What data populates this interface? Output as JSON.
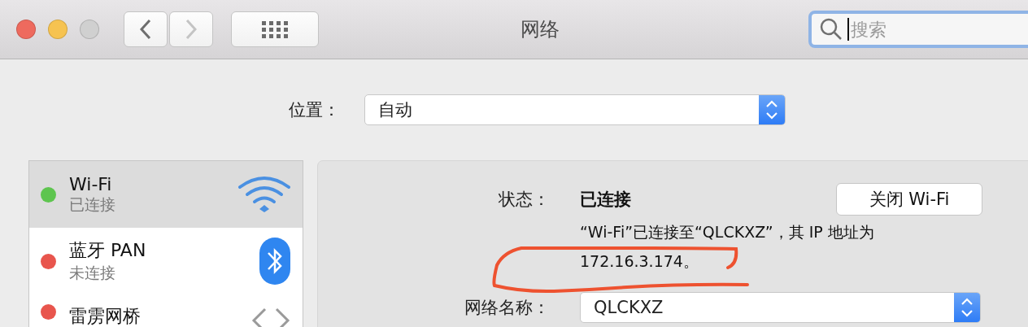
{
  "window": {
    "title": "网络"
  },
  "nav": [
    {
      "kind": "back",
      "disabled": false
    },
    {
      "kind": "forward",
      "disabled": true
    }
  ],
  "search": {
    "placeholder": "搜索",
    "focused": true
  },
  "location": {
    "label": "位置：",
    "value": "自动"
  },
  "services": [
    {
      "kind": "wifi",
      "name": "Wi-Fi",
      "status": "已连接",
      "color": "#5ec54f",
      "selected": true
    },
    {
      "kind": "bluetooth",
      "name": "蓝牙 PAN",
      "status": "未连接",
      "color": "#e8554d",
      "selected": false
    },
    {
      "kind": "bridge",
      "name": "雷雳网桥",
      "color": "#e8554d",
      "selected": false
    }
  ],
  "detail": {
    "status_label": "状态：",
    "status_value": "已连接",
    "toggle_button": "关闭 Wi-Fi",
    "description": "“Wi-Fi”已连接至“QLCKXZ”，其 IP 地址为 172.16.3.174。",
    "network_name_label": "网络名称：",
    "network_name": "QLCKXZ"
  }
}
